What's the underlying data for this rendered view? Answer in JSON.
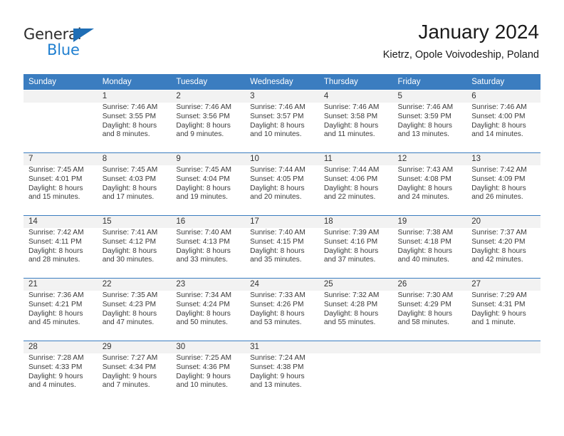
{
  "logo": {
    "text_primary": "General",
    "text_secondary": "Blue",
    "triangle_color": "#1f6eb5",
    "secondary_color": "#1f7fd0"
  },
  "header": {
    "title": "January 2024",
    "subtitle": "Kietrz, Opole Voivodeship, Poland"
  },
  "theme": {
    "header_bg": "#3b7dc0",
    "daynum_bg": "#f2f2f2",
    "text": "#3a3a3a"
  },
  "calendar": {
    "weekday_headers": [
      "Sunday",
      "Monday",
      "Tuesday",
      "Wednesday",
      "Thursday",
      "Friday",
      "Saturday"
    ],
    "weeks": [
      {
        "days": [
          {
            "num": "",
            "lines": [
              "",
              "",
              "",
              ""
            ]
          },
          {
            "num": "1",
            "lines": [
              "Sunrise: 7:46 AM",
              "Sunset: 3:55 PM",
              "Daylight: 8 hours",
              "and 8 minutes."
            ]
          },
          {
            "num": "2",
            "lines": [
              "Sunrise: 7:46 AM",
              "Sunset: 3:56 PM",
              "Daylight: 8 hours",
              "and 9 minutes."
            ]
          },
          {
            "num": "3",
            "lines": [
              "Sunrise: 7:46 AM",
              "Sunset: 3:57 PM",
              "Daylight: 8 hours",
              "and 10 minutes."
            ]
          },
          {
            "num": "4",
            "lines": [
              "Sunrise: 7:46 AM",
              "Sunset: 3:58 PM",
              "Daylight: 8 hours",
              "and 11 minutes."
            ]
          },
          {
            "num": "5",
            "lines": [
              "Sunrise: 7:46 AM",
              "Sunset: 3:59 PM",
              "Daylight: 8 hours",
              "and 13 minutes."
            ]
          },
          {
            "num": "6",
            "lines": [
              "Sunrise: 7:46 AM",
              "Sunset: 4:00 PM",
              "Daylight: 8 hours",
              "and 14 minutes."
            ]
          }
        ]
      },
      {
        "days": [
          {
            "num": "7",
            "lines": [
              "Sunrise: 7:45 AM",
              "Sunset: 4:01 PM",
              "Daylight: 8 hours",
              "and 15 minutes."
            ]
          },
          {
            "num": "8",
            "lines": [
              "Sunrise: 7:45 AM",
              "Sunset: 4:03 PM",
              "Daylight: 8 hours",
              "and 17 minutes."
            ]
          },
          {
            "num": "9",
            "lines": [
              "Sunrise: 7:45 AM",
              "Sunset: 4:04 PM",
              "Daylight: 8 hours",
              "and 19 minutes."
            ]
          },
          {
            "num": "10",
            "lines": [
              "Sunrise: 7:44 AM",
              "Sunset: 4:05 PM",
              "Daylight: 8 hours",
              "and 20 minutes."
            ]
          },
          {
            "num": "11",
            "lines": [
              "Sunrise: 7:44 AM",
              "Sunset: 4:06 PM",
              "Daylight: 8 hours",
              "and 22 minutes."
            ]
          },
          {
            "num": "12",
            "lines": [
              "Sunrise: 7:43 AM",
              "Sunset: 4:08 PM",
              "Daylight: 8 hours",
              "and 24 minutes."
            ]
          },
          {
            "num": "13",
            "lines": [
              "Sunrise: 7:42 AM",
              "Sunset: 4:09 PM",
              "Daylight: 8 hours",
              "and 26 minutes."
            ]
          }
        ]
      },
      {
        "days": [
          {
            "num": "14",
            "lines": [
              "Sunrise: 7:42 AM",
              "Sunset: 4:11 PM",
              "Daylight: 8 hours",
              "and 28 minutes."
            ]
          },
          {
            "num": "15",
            "lines": [
              "Sunrise: 7:41 AM",
              "Sunset: 4:12 PM",
              "Daylight: 8 hours",
              "and 30 minutes."
            ]
          },
          {
            "num": "16",
            "lines": [
              "Sunrise: 7:40 AM",
              "Sunset: 4:13 PM",
              "Daylight: 8 hours",
              "and 33 minutes."
            ]
          },
          {
            "num": "17",
            "lines": [
              "Sunrise: 7:40 AM",
              "Sunset: 4:15 PM",
              "Daylight: 8 hours",
              "and 35 minutes."
            ]
          },
          {
            "num": "18",
            "lines": [
              "Sunrise: 7:39 AM",
              "Sunset: 4:16 PM",
              "Daylight: 8 hours",
              "and 37 minutes."
            ]
          },
          {
            "num": "19",
            "lines": [
              "Sunrise: 7:38 AM",
              "Sunset: 4:18 PM",
              "Daylight: 8 hours",
              "and 40 minutes."
            ]
          },
          {
            "num": "20",
            "lines": [
              "Sunrise: 7:37 AM",
              "Sunset: 4:20 PM",
              "Daylight: 8 hours",
              "and 42 minutes."
            ]
          }
        ]
      },
      {
        "days": [
          {
            "num": "21",
            "lines": [
              "Sunrise: 7:36 AM",
              "Sunset: 4:21 PM",
              "Daylight: 8 hours",
              "and 45 minutes."
            ]
          },
          {
            "num": "22",
            "lines": [
              "Sunrise: 7:35 AM",
              "Sunset: 4:23 PM",
              "Daylight: 8 hours",
              "and 47 minutes."
            ]
          },
          {
            "num": "23",
            "lines": [
              "Sunrise: 7:34 AM",
              "Sunset: 4:24 PM",
              "Daylight: 8 hours",
              "and 50 minutes."
            ]
          },
          {
            "num": "24",
            "lines": [
              "Sunrise: 7:33 AM",
              "Sunset: 4:26 PM",
              "Daylight: 8 hours",
              "and 53 minutes."
            ]
          },
          {
            "num": "25",
            "lines": [
              "Sunrise: 7:32 AM",
              "Sunset: 4:28 PM",
              "Daylight: 8 hours",
              "and 55 minutes."
            ]
          },
          {
            "num": "26",
            "lines": [
              "Sunrise: 7:30 AM",
              "Sunset: 4:29 PM",
              "Daylight: 8 hours",
              "and 58 minutes."
            ]
          },
          {
            "num": "27",
            "lines": [
              "Sunrise: 7:29 AM",
              "Sunset: 4:31 PM",
              "Daylight: 9 hours",
              "and 1 minute."
            ]
          }
        ]
      },
      {
        "days": [
          {
            "num": "28",
            "lines": [
              "Sunrise: 7:28 AM",
              "Sunset: 4:33 PM",
              "Daylight: 9 hours",
              "and 4 minutes."
            ]
          },
          {
            "num": "29",
            "lines": [
              "Sunrise: 7:27 AM",
              "Sunset: 4:34 PM",
              "Daylight: 9 hours",
              "and 7 minutes."
            ]
          },
          {
            "num": "30",
            "lines": [
              "Sunrise: 7:25 AM",
              "Sunset: 4:36 PM",
              "Daylight: 9 hours",
              "and 10 minutes."
            ]
          },
          {
            "num": "31",
            "lines": [
              "Sunrise: 7:24 AM",
              "Sunset: 4:38 PM",
              "Daylight: 9 hours",
              "and 13 minutes."
            ]
          },
          {
            "num": "",
            "lines": [
              "",
              "",
              "",
              ""
            ]
          },
          {
            "num": "",
            "lines": [
              "",
              "",
              "",
              ""
            ]
          },
          {
            "num": "",
            "lines": [
              "",
              "",
              "",
              ""
            ]
          }
        ]
      }
    ]
  }
}
